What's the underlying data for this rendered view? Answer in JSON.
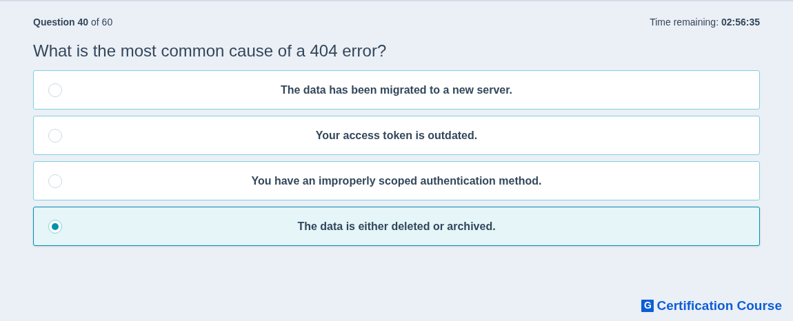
{
  "progress": {
    "text": "**Question 40** of 60"
  },
  "timer": {
    "text": "Time remaining: **02:56:35**"
  },
  "question": "What is the most common cause of a 404 error?",
  "options": [
    {
      "label": "The data has been migrated to a new server.",
      "selected": false
    },
    {
      "label": "Your access token is outdated.",
      "selected": false
    },
    {
      "label": "You have an improperly scoped authentication method.",
      "selected": false
    },
    {
      "label": "The data is either deleted or archived.",
      "selected": true
    }
  ],
  "brand": {
    "mark": "G",
    "name": "Certification Course"
  }
}
